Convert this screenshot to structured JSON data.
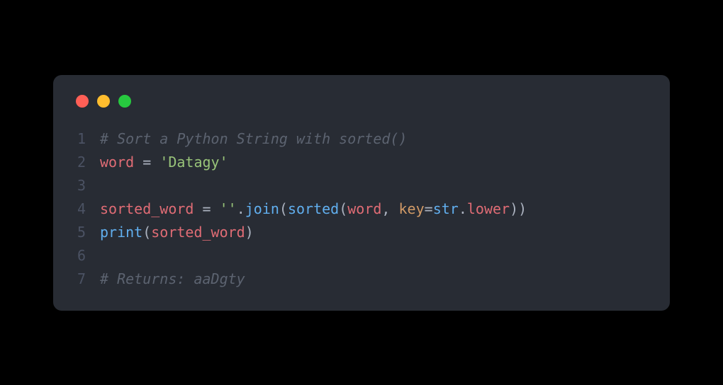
{
  "titlebar": {
    "dots": [
      "red",
      "yellow",
      "green"
    ]
  },
  "lines": [
    {
      "no": "1",
      "tokens": [
        {
          "cls": "comment",
          "text": "# Sort a Python String with sorted()"
        }
      ]
    },
    {
      "no": "2",
      "tokens": [
        {
          "cls": "ident",
          "text": "word"
        },
        {
          "cls": "plain",
          "text": " "
        },
        {
          "cls": "op",
          "text": "="
        },
        {
          "cls": "plain",
          "text": " "
        },
        {
          "cls": "string",
          "text": "'Datagy'"
        }
      ]
    },
    {
      "no": "3",
      "tokens": []
    },
    {
      "no": "4",
      "tokens": [
        {
          "cls": "ident",
          "text": "sorted_word"
        },
        {
          "cls": "plain",
          "text": " "
        },
        {
          "cls": "op",
          "text": "="
        },
        {
          "cls": "plain",
          "text": " "
        },
        {
          "cls": "string",
          "text": "''"
        },
        {
          "cls": "plain",
          "text": "."
        },
        {
          "cls": "method",
          "text": "join"
        },
        {
          "cls": "plain",
          "text": "("
        },
        {
          "cls": "builtin",
          "text": "sorted"
        },
        {
          "cls": "plain",
          "text": "("
        },
        {
          "cls": "ident",
          "text": "word"
        },
        {
          "cls": "plain",
          "text": ", "
        },
        {
          "cls": "param",
          "text": "key"
        },
        {
          "cls": "op",
          "text": "="
        },
        {
          "cls": "builtin",
          "text": "str"
        },
        {
          "cls": "plain",
          "text": "."
        },
        {
          "cls": "attr",
          "text": "lower"
        },
        {
          "cls": "plain",
          "text": "))"
        }
      ]
    },
    {
      "no": "5",
      "tokens": [
        {
          "cls": "builtin",
          "text": "print"
        },
        {
          "cls": "plain",
          "text": "("
        },
        {
          "cls": "ident",
          "text": "sorted_word"
        },
        {
          "cls": "plain",
          "text": ")"
        }
      ]
    },
    {
      "no": "6",
      "tokens": []
    },
    {
      "no": "7",
      "tokens": [
        {
          "cls": "comment",
          "text": "# Returns: aaDgty"
        }
      ]
    }
  ]
}
